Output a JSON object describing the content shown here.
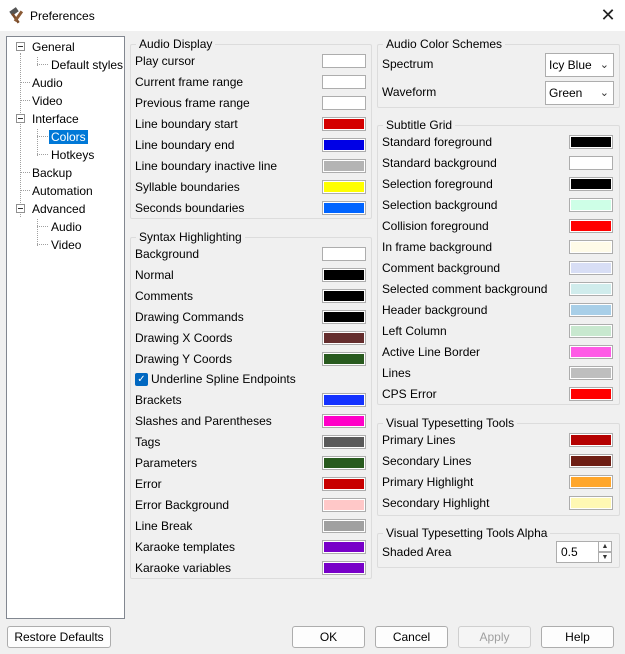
{
  "window": {
    "title": "Preferences",
    "close_glyph": "✕"
  },
  "tree": [
    "General",
    "Default styles",
    "Audio",
    "Video",
    "Interface",
    "Colors",
    "Hotkeys",
    "Backup",
    "Automation",
    "Advanced",
    "Audio",
    "Video"
  ],
  "audio_display": {
    "title": "Audio Display",
    "items": [
      {
        "label": "Play cursor",
        "color": "#ffffff"
      },
      {
        "label": "Current frame range",
        "color": "#ffffff"
      },
      {
        "label": "Previous frame range",
        "color": "#ffffff"
      },
      {
        "label": "Line boundary start",
        "color": "#d40000"
      },
      {
        "label": "Line boundary end",
        "color": "#0000e6"
      },
      {
        "label": "Line boundary inactive line",
        "color": "#b4b4b4"
      },
      {
        "label": "Syllable boundaries",
        "color": "#ffff00"
      },
      {
        "label": "Seconds boundaries",
        "color": "#0064ff"
      }
    ]
  },
  "syntax": {
    "title": "Syntax Highlighting",
    "items_a": [
      {
        "label": "Background",
        "color": "#ffffff"
      },
      {
        "label": "Normal",
        "color": "#000000"
      },
      {
        "label": "Comments",
        "color": "#000000"
      },
      {
        "label": "Drawing Commands",
        "color": "#000000"
      },
      {
        "label": "Drawing X Coords",
        "color": "#642d2d"
      },
      {
        "label": "Drawing Y Coords",
        "color": "#285a1e"
      }
    ],
    "checkbox_label": "Underline Spline Endpoints",
    "items_b": [
      {
        "label": "Brackets",
        "color": "#1432ff"
      },
      {
        "label": "Slashes and Parentheses",
        "color": "#ff00c8"
      },
      {
        "label": "Tags",
        "color": "#5a5a5a"
      },
      {
        "label": "Parameters",
        "color": "#285a1e"
      },
      {
        "label": "Error",
        "color": "#c80000"
      },
      {
        "label": "Error Background",
        "color": "#ffc8c8"
      },
      {
        "label": "Line Break",
        "color": "#a0a0a0"
      },
      {
        "label": "Karaoke templates",
        "color": "#7800c8"
      },
      {
        "label": "Karaoke variables",
        "color": "#7800c8"
      }
    ]
  },
  "audio_color_schemes": {
    "title": "Audio Color Schemes",
    "spectrum_label": "Spectrum",
    "spectrum_value": "Icy Blue",
    "waveform_label": "Waveform",
    "waveform_value": "Green",
    "dropdown_glyph": "⌄"
  },
  "subtitle_grid": {
    "title": "Subtitle Grid",
    "items": [
      {
        "label": "Standard foreground",
        "color": "#000000"
      },
      {
        "label": "Standard background",
        "color": "#ffffff"
      },
      {
        "label": "Selection foreground",
        "color": "#000000"
      },
      {
        "label": "Selection background",
        "color": "#ceffe7"
      },
      {
        "label": "Collision foreground",
        "color": "#ff0000"
      },
      {
        "label": "In frame background",
        "color": "#fffbe8"
      },
      {
        "label": "Comment background",
        "color": "#d8def5"
      },
      {
        "label": "Selected comment background",
        "color": "#d0ecec"
      },
      {
        "label": "Header background",
        "color": "#a8cfe8"
      },
      {
        "label": "Left Column",
        "color": "#c8e8cf"
      },
      {
        "label": "Active Line Border",
        "color": "#ff5ae6"
      },
      {
        "label": "Lines",
        "color": "#bebebe"
      },
      {
        "label": "CPS Error",
        "color": "#ff0000"
      }
    ]
  },
  "visual_tools": {
    "title": "Visual Typesetting Tools",
    "items": [
      {
        "label": "Primary Lines",
        "color": "#b40000"
      },
      {
        "label": "Secondary Lines",
        "color": "#6e1e14"
      },
      {
        "label": "Primary Highlight",
        "color": "#ffa62b"
      },
      {
        "label": "Secondary Highlight",
        "color": "#fff8b4"
      }
    ]
  },
  "visual_tools_alpha": {
    "title": "Visual Typesetting Tools Alpha",
    "shaded_area_label": "Shaded Area",
    "shaded_area_value": "0.5",
    "up_glyph": "▲",
    "down_glyph": "▼"
  },
  "buttons": {
    "restore_defaults": "Restore Defaults",
    "ok": "OK",
    "cancel": "Cancel",
    "apply": "Apply",
    "help": "Help"
  }
}
